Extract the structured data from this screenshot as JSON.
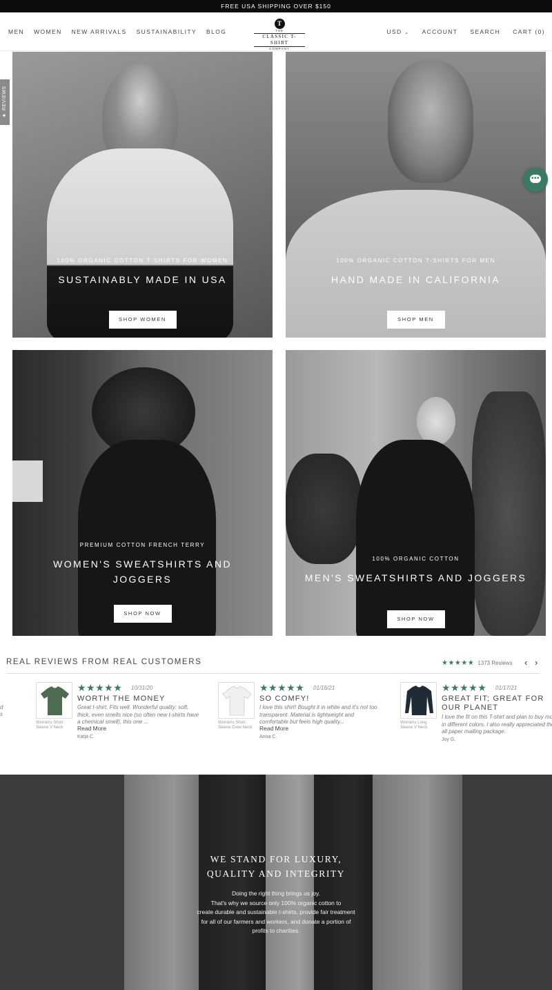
{
  "announcement": "FREE USA SHIPPING OVER $150",
  "nav": {
    "left": [
      "MEN",
      "WOMEN",
      "NEW ARRIVALS",
      "SUSTAINABILITY",
      "BLOG"
    ],
    "currency": "USD",
    "account": "ACCOUNT",
    "search": "SEARCH",
    "cart": "CART (0)"
  },
  "logo": {
    "mark": "T",
    "top": "THE",
    "main": "CLASSIC T-SHIRT",
    "bottom": "COMPANY"
  },
  "reviews_tab": "★ REVIEWS",
  "tiles": [
    {
      "eyebrow": "100% ORGANIC COTTON T-SHIRTS FOR WOMEN",
      "heading": "SUSTAINABLY MADE IN USA",
      "button": "SHOP WOMEN"
    },
    {
      "eyebrow": "100% ORGANIC COTTON T-SHIRTS FOR MEN",
      "heading": "HAND MADE IN CALIFORNIA",
      "button": "SHOP MEN"
    },
    {
      "eyebrow": "PREMIUM COTTON FRENCH TERRY",
      "heading": "WOMEN'S SWEATSHIRTS AND JOGGERS",
      "button": "SHOP NOW"
    },
    {
      "eyebrow": "100% ORGANIC COTTON",
      "heading": "MEN'S SWEATSHIRTS AND JOGGERS",
      "button": "SHOP NOW"
    }
  ],
  "reviews": {
    "title": "REAL REVIEWS FROM REAL CUSTOMERS",
    "stars": "★★★★★",
    "count": "1373 Reviews",
    "prev": "‹",
    "next": "›",
    "items": [
      {
        "product": "Womens Short Sleeve V Neck",
        "stars": "★★★★★",
        "date": "10/31/20",
        "title": "WORTH THE MONEY",
        "body": "Great t-shirt. Fits well. Wonderful quality: soft, thick, even smells nice (so often new t-shirts have a chemical smell), this one ...",
        "more": "Read More",
        "name": "Katja C.",
        "color": "#4f6b52"
      },
      {
        "product": "Womens Short Sleeve Crew Neck",
        "stars": "★★★★★",
        "date": "01/16/21",
        "title": "SO COMFY!",
        "body": "I love this shirt! Bought it in white and it's not too transparent. Material is lightweight and comfortable but feels high quality...",
        "more": "Read More",
        "name": "Anna C.",
        "color": "#eeeeee"
      },
      {
        "product": "Womens Long Sleeve V Neck",
        "stars": "★★★★★",
        "date": "01/17/21",
        "title": "GREAT FIT; GREAT FOR OUR PLANET",
        "body": "I love the fit on this T-shirt and plan to buy more in different colors. I also really appreciated the all paper mailing package.",
        "more": "",
        "name": "Joy G.",
        "color": "#1f2b36"
      }
    ]
  },
  "mission": {
    "title_line1": "WE STAND FOR LUXURY,",
    "title_line2": "QUALITY AND INTEGRITY",
    "text": [
      "Doing the right thing brings us joy.",
      "That's why we source only 100% organic cotton to",
      "create durable and sustainable t-shirts, provide fair treatment",
      "for all of our farmers and workers, and donate a portion of",
      "profits to charities."
    ]
  }
}
